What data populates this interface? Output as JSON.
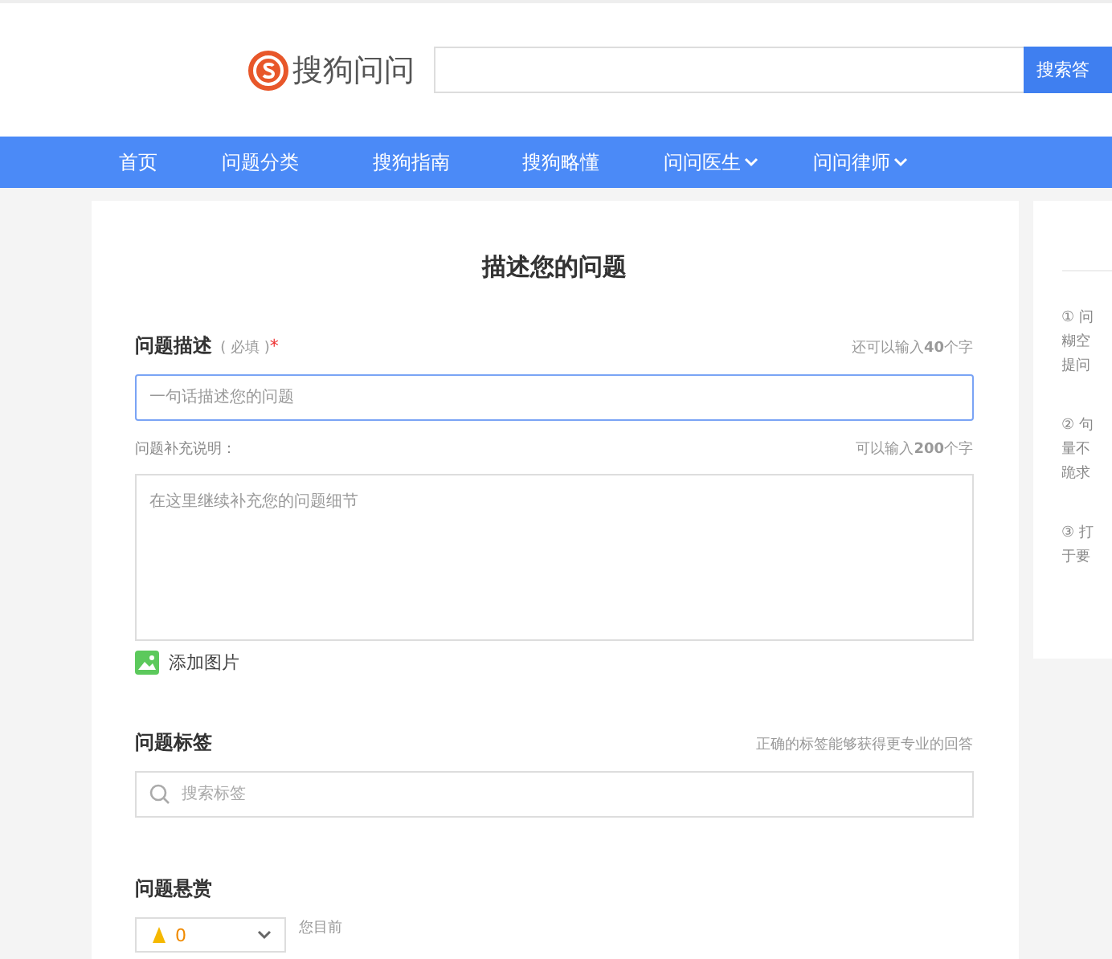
{
  "header": {
    "logo_text": "搜狗问问",
    "search_button": "搜索答"
  },
  "nav": [
    {
      "label": "首页",
      "dropdown": false
    },
    {
      "label": "问题分类",
      "dropdown": false
    },
    {
      "label": "搜狗指南",
      "dropdown": false
    },
    {
      "label": "搜狗略懂",
      "dropdown": false
    },
    {
      "label": "问问医生",
      "dropdown": true
    },
    {
      "label": "问问律师",
      "dropdown": true
    }
  ],
  "form": {
    "title": "描述您的问题",
    "question": {
      "label": "问题描述",
      "hint": "( 必填 )",
      "required": "*",
      "counter": "还可以输入**40**个字",
      "placeholder": "一句话描述您的问题",
      "focused": true
    },
    "details": {
      "label": "问题补充说明：",
      "counter": "可以输入**200**个字",
      "placeholder": "在这里继续补充您的问题细节"
    },
    "add_image": "添加图片",
    "tags": {
      "label": "问题标签",
      "note": "正确的标签能够获得更专业的回答",
      "placeholder": "搜索标签"
    },
    "reward": {
      "label": "问题悬赏",
      "value": "0",
      "note": "您目前"
    }
  },
  "side_tips": [
    [
      "① 问",
      "糊空",
      "提问"
    ],
    [
      "② 句",
      "量不",
      "跪求"
    ],
    [
      "③ 打",
      "于要"
    ]
  ]
}
